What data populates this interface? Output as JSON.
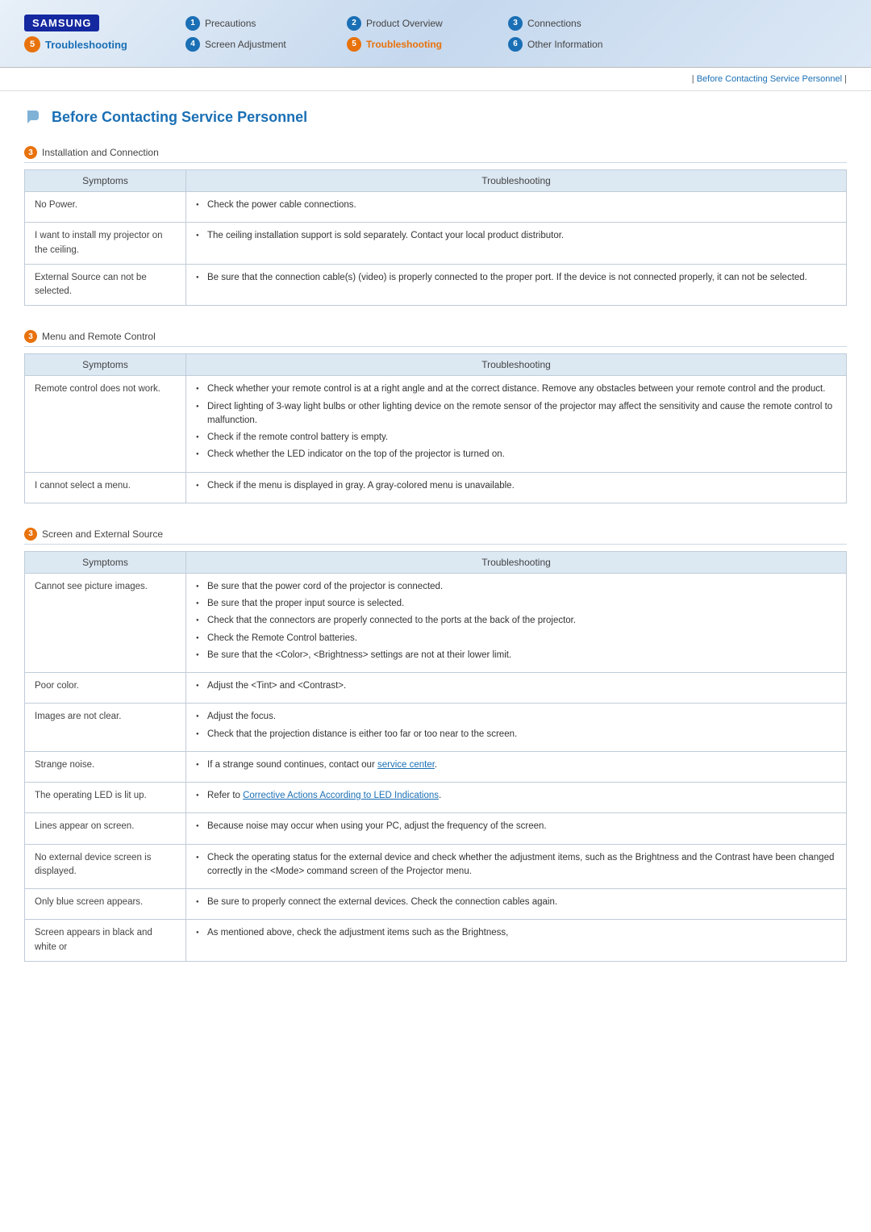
{
  "header": {
    "logo": "SAMSUNG",
    "active_section_number": "5",
    "active_section_label": "Troubleshooting",
    "nav_items": [
      {
        "number": "1",
        "label": "Precautions",
        "active": false
      },
      {
        "number": "2",
        "label": "Product Overview",
        "active": false
      },
      {
        "number": "3",
        "label": "Connections",
        "active": false
      },
      {
        "number": "4",
        "label": "Screen Adjustment",
        "active": false
      },
      {
        "number": "5",
        "label": "Troubleshooting",
        "active": true
      },
      {
        "number": "6",
        "label": "Other Information",
        "active": false
      }
    ]
  },
  "breadcrumb": {
    "separator": "|",
    "link_text": "Before Contacting Service Personnel"
  },
  "page_title": "Before Contacting Service Personnel",
  "sections": [
    {
      "id": "installation",
      "icon_label": "3",
      "title": "Installation and Connection",
      "columns": [
        "Symptoms",
        "Troubleshooting"
      ],
      "rows": [
        {
          "symptom": "No Power.",
          "troubleshooting": [
            "Check the power cable connections."
          ]
        },
        {
          "symptom": "I want to install my projector on the ceiling.",
          "troubleshooting": [
            "The ceiling installation support is sold separately. Contact your local product distributor."
          ]
        },
        {
          "symptom": "External Source can not be selected.",
          "troubleshooting": [
            "Be sure that the connection cable(s) (video) is properly connected to the proper port. If the device is not connected properly, it can not be selected."
          ]
        }
      ]
    },
    {
      "id": "menu_remote",
      "icon_label": "3",
      "title": "Menu and Remote Control",
      "columns": [
        "Symptoms",
        "Troubleshooting"
      ],
      "rows": [
        {
          "symptom": "Remote control does not work.",
          "troubleshooting": [
            "Check whether your remote control is at a right angle and at the correct distance. Remove any obstacles between your remote control and the product.",
            "Direct lighting of 3-way light bulbs or other lighting device on the remote sensor of the projector may affect the sensitivity and cause the remote control to malfunction.",
            "Check if the remote control battery is empty.",
            "Check whether the LED indicator on the top of the projector is turned on."
          ]
        },
        {
          "symptom": "I cannot select a menu.",
          "troubleshooting": [
            "Check if the menu is displayed in gray. A gray-colored menu is unavailable."
          ]
        }
      ]
    },
    {
      "id": "screen_external",
      "icon_label": "3",
      "title": "Screen and External Source",
      "columns": [
        "Symptoms",
        "Troubleshooting"
      ],
      "rows": [
        {
          "symptom": "Cannot see picture images.",
          "troubleshooting": [
            "Be sure that the power cord of the projector is connected.",
            "Be sure that the proper input source is selected.",
            "Check that the connectors are properly connected to the ports at the back of the projector.",
            "Check the Remote Control batteries.",
            "Be sure that the <Color>, <Brightness> settings are not at their lower limit."
          ]
        },
        {
          "symptom": "Poor color.",
          "troubleshooting": [
            "Adjust the <Tint> and <Contrast>."
          ]
        },
        {
          "symptom": "Images are not clear.",
          "troubleshooting": [
            "Adjust the focus.",
            "Check that the projection distance is either too far or too near to the screen."
          ]
        },
        {
          "symptom": "Strange noise.",
          "troubleshooting": [
            "If a strange sound continues, contact our service center."
          ],
          "has_link": true,
          "link_index": 0,
          "link_text": "service center"
        },
        {
          "symptom": "The operating LED is lit up.",
          "troubleshooting": [
            "Refer to Corrective Actions According to LED Indications."
          ],
          "has_link": true,
          "link_index": 0,
          "link_text": "Corrective Actions According to LED Indications"
        },
        {
          "symptom": "Lines appear on screen.",
          "troubleshooting": [
            "Because noise may occur when using your PC, adjust the frequency of the screen."
          ]
        },
        {
          "symptom": "No external device screen is displayed.",
          "troubleshooting": [
            "Check the operating status for the external device and check whether the adjustment items, such as the Brightness and the Contrast have been changed correctly in the <Mode> command screen of the Projector menu."
          ]
        },
        {
          "symptom": "Only blue screen appears.",
          "troubleshooting": [
            "Be sure to properly connect the external devices. Check the connection cables again."
          ]
        },
        {
          "symptom": "Screen appears in black and white or",
          "troubleshooting": [
            "As mentioned above, check the adjustment items such as the Brightness,"
          ]
        }
      ]
    }
  ]
}
